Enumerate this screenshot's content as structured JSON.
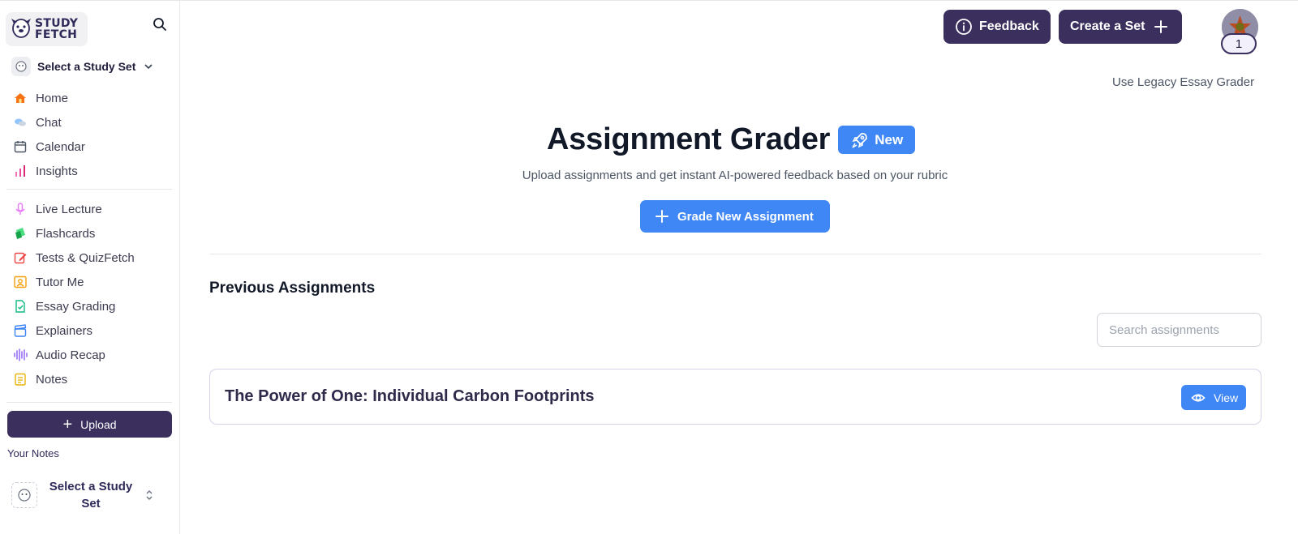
{
  "brand": {
    "logo_line1": "STUDY",
    "logo_line2": "FETCH"
  },
  "sidebar": {
    "study_set_select": "Select a Study Set",
    "nav_primary": [
      {
        "label": "Home",
        "icon": "home-icon",
        "color": "#f97316"
      },
      {
        "label": "Chat",
        "icon": "chat-icon",
        "color": "#60a5fa"
      },
      {
        "label": "Calendar",
        "icon": "calendar-icon",
        "color": "#4b5563"
      },
      {
        "label": "Insights",
        "icon": "insights-icon",
        "color": "#ec4899"
      }
    ],
    "nav_tools": [
      {
        "label": "Live Lecture",
        "icon": "microphone-icon",
        "color": "#e879f9"
      },
      {
        "label": "Flashcards",
        "icon": "flashcards-icon",
        "color": "#22c55e"
      },
      {
        "label": "Tests & QuizFetch",
        "icon": "pencil-icon",
        "color": "#ef4444"
      },
      {
        "label": "Tutor Me",
        "icon": "tutor-icon",
        "color": "#f59e0b"
      },
      {
        "label": "Essay Grading",
        "icon": "essay-icon",
        "color": "#10b981"
      },
      {
        "label": "Explainers",
        "icon": "clapper-icon",
        "color": "#3b82f6"
      },
      {
        "label": "Audio Recap",
        "icon": "waveform-icon",
        "color": "#8b5cf6"
      },
      {
        "label": "Notes",
        "icon": "notes-icon",
        "color": "#eab308"
      }
    ],
    "upload_label": "Upload",
    "your_notes_label": "Your Notes",
    "notes_study_set": "Select a Study Set"
  },
  "header": {
    "feedback_label": "Feedback",
    "create_set_label": "Create a Set",
    "notification_count": "1",
    "legacy_link": "Use Legacy Essay Grader"
  },
  "main": {
    "title": "Assignment Grader",
    "new_badge": "New",
    "subtitle": "Upload assignments and get instant AI-powered feedback based on your rubric",
    "grade_button": "Grade New Assignment",
    "section_title": "Previous Assignments",
    "search_placeholder": "Search assignments",
    "assignments": [
      {
        "title": "The Power of One: Individual Carbon Footprints",
        "action": "View"
      }
    ]
  },
  "colors": {
    "primary_dark": "#3b2f5e",
    "accent_blue": "#3f87f5"
  }
}
